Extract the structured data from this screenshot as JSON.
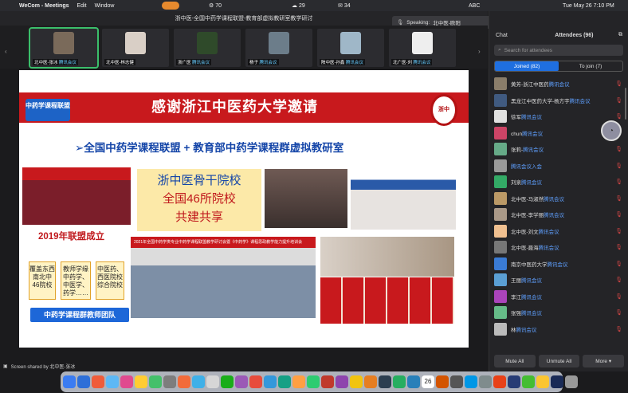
{
  "menubar": {
    "app": "WeCom - Meetings",
    "items": [
      "Edit",
      "Window"
    ],
    "tray": [
      "70",
      "29",
      "34",
      "ABC"
    ],
    "datetime": "Tue May 26  7:10 PM"
  },
  "window": {
    "title": "浙中医-全国中药学课程联盟-教育部虚拟教研室教学研讨",
    "speaking_label": "Speaking:",
    "speaking_name": "北中医-欧阳"
  },
  "participants_strip": [
    {
      "name": "北中医-张冰",
      "sub": "腾讯会议"
    },
    {
      "name": "北中医-林志健",
      "sub": ""
    },
    {
      "name": "浙广医",
      "sub": "腾讯会议"
    },
    {
      "name": "杨子",
      "sub": "腾讯会议"
    },
    {
      "name": "陕中医-孙鑫",
      "sub": "腾讯会议"
    },
    {
      "name": "北广医-刘",
      "sub": "腾讯会议"
    }
  ],
  "slide": {
    "title": "感谢浙江中医药大学邀请",
    "logo_left": "中药学课程联盟",
    "logo_right": "浙中",
    "subtitle": "➢全国中药学课程联盟 + 教育部中药学课程群虚拟教研室",
    "callout": [
      "浙中医骨干院校",
      "全国46所院校",
      "共建共享"
    ],
    "year": "2019年联盟成立",
    "boxes": [
      "覆盖东西南北中46院校",
      "教师学缘中药学、中医学、药学……",
      "中医药、西医院校综合院校"
    ],
    "team_button": "中药学课程群教师团队",
    "banner": "2021年全国中药学类专业中药学课程联盟教学研讨会暨《中药学》课程思政教学能力提升培训会"
  },
  "share_bar": {
    "label": "Screen shared by 北中医-张冰"
  },
  "panel": {
    "tab_chat": "Chat",
    "tab_attendees": "Attendees (96)",
    "search_placeholder": "Search for attendees",
    "joined": "Joined (82)",
    "to_join": "To join (7)",
    "attendees": [
      {
        "name": "黄芳-浙江中医药",
        "sub": "腾讯会议"
      },
      {
        "name": "黑龙江中医药大学-杨方宇",
        "sub": "腾讯会议"
      },
      {
        "name": "徐军",
        "sub": "腾讯会议"
      },
      {
        "name": "chun",
        "sub": "腾讯会议"
      },
      {
        "name": "张莉-",
        "sub": "腾讯会议"
      },
      {
        "name": "",
        "sub": "腾讯会议入会"
      },
      {
        "name": "刘泉",
        "sub": "腾讯会议"
      },
      {
        "name": "北中医-马淑然",
        "sub": "腾讯会议"
      },
      {
        "name": "北中医-李学丽",
        "sub": "腾讯会议"
      },
      {
        "name": "北中医-刘文",
        "sub": "腾讯会议"
      },
      {
        "name": "北中医-聂海",
        "sub": "腾讯会议"
      },
      {
        "name": "南京中医药大学",
        "sub": "腾讯会议"
      },
      {
        "name": "王丽",
        "sub": "腾讯会议"
      },
      {
        "name": "李江",
        "sub": "腾讯会议"
      },
      {
        "name": "张强",
        "sub": "腾讯会议"
      },
      {
        "name": "林",
        "sub": "腾讯会议"
      }
    ],
    "btn_mute_all": "Mute All",
    "btn_unmute_all": "Unmute All",
    "btn_more": "More ▾"
  },
  "dock": {
    "calendar_day": "26"
  },
  "colors": {
    "accent": "#1f6fe0",
    "slide_red": "#c8191d",
    "slide_blue": "#1445a8"
  }
}
